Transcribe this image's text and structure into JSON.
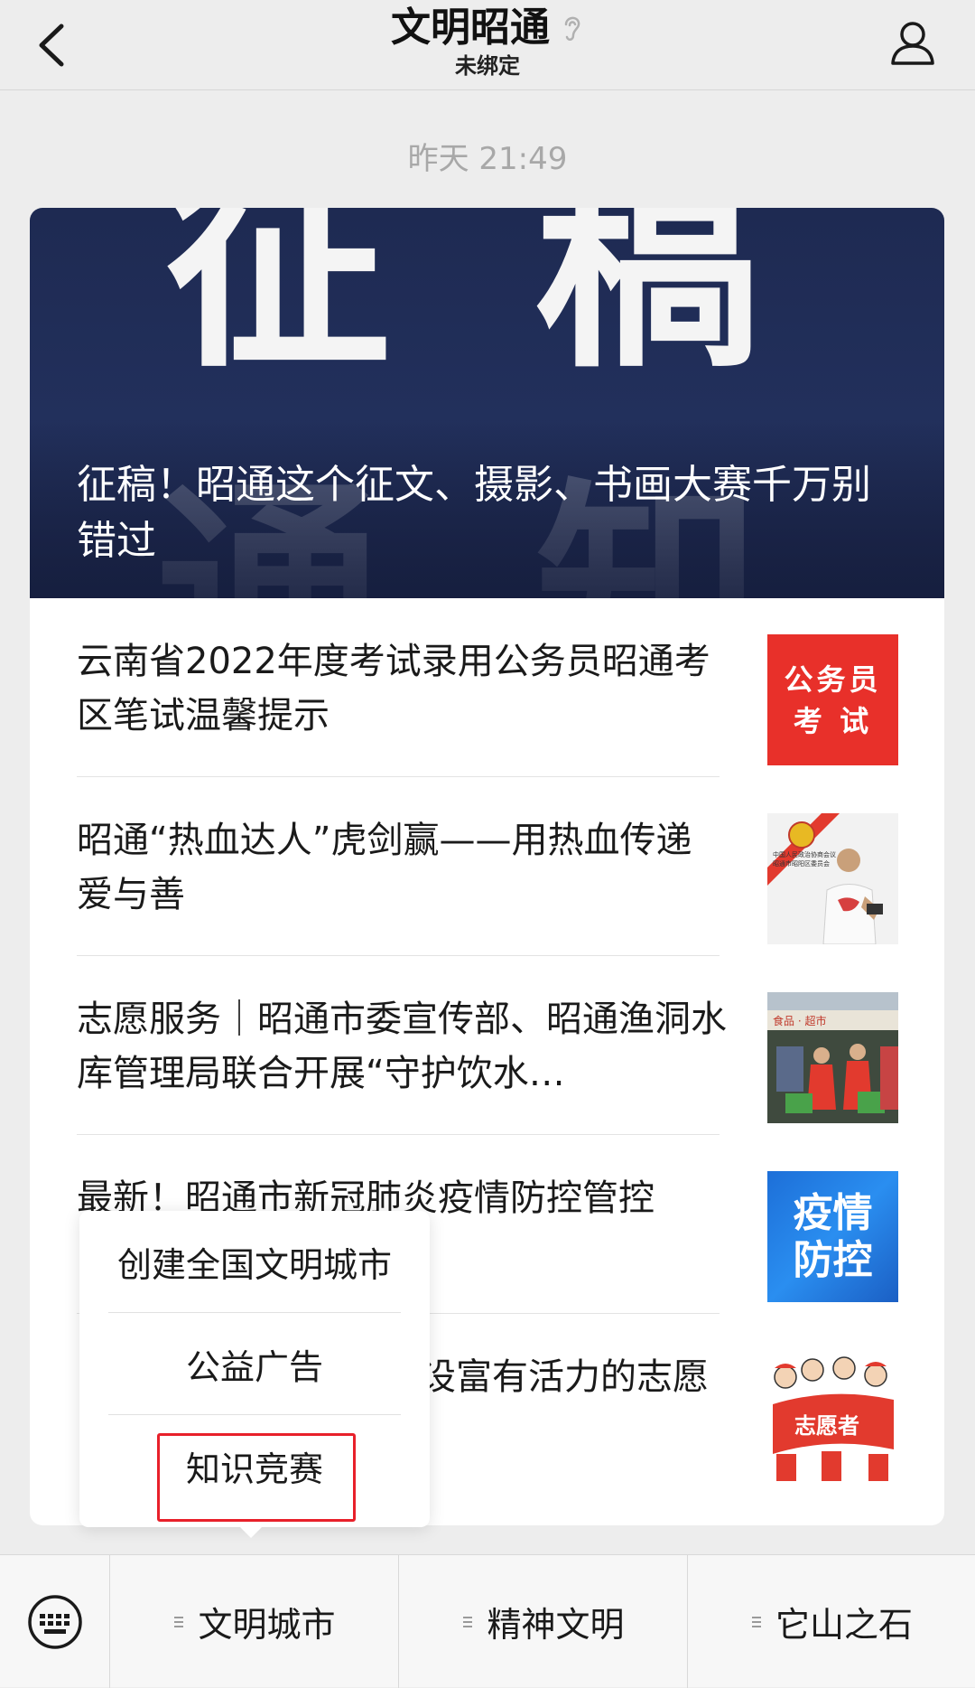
{
  "header": {
    "title": "文明昭通",
    "subtitle": "未绑定",
    "back_icon": "chevron-left-icon",
    "user_icon": "person-icon",
    "ear_icon": "ear-icon"
  },
  "timestamp": "昨天 21:49",
  "cover": {
    "bg_glyphs": [
      "征",
      "稿",
      "通",
      "知"
    ],
    "title": "征稿！昭通这个征文、摄影、书画大赛千万别错过"
  },
  "articles": [
    {
      "title": "云南省2022年度考试录用公务员昭通考区笔试温馨提示",
      "thumb": {
        "type": "text",
        "lines": [
          "公务员",
          "考 试"
        ]
      }
    },
    {
      "title": "昭通“热血达人”虎剑赢——用热血传递爱与善",
      "thumb": {
        "type": "photo",
        "caption_lines": [
          "中国人民政治协商会议",
          "昭通市昭阳区委员会"
        ]
      }
    },
    {
      "title": "志愿服务｜昭通市委宣传部、昭通渔洞水库管理局联合开展“守护饮水…",
      "thumb": {
        "type": "photo",
        "caption_lines": [
          "食品 · 超市"
        ]
      }
    },
    {
      "title": "最新！昭通市新冠肺炎疫情防控管控",
      "thumb": {
        "type": "text",
        "lines": [
          "疫情",
          "防控"
        ]
      }
    },
    {
      "title": "设富有活力的志愿",
      "thumb": {
        "type": "cartoon",
        "banner": "志愿者"
      }
    }
  ],
  "popup_menu": {
    "items": [
      "创建全国文明城市",
      "公益广告",
      "知识竞赛"
    ],
    "highlighted_index": 2,
    "highlight_color": "#e8202a"
  },
  "menubar": {
    "keyboard_icon": "keyboard-icon",
    "tabs": [
      "文明城市",
      "精神文明",
      "它山之石"
    ],
    "tab_icon": "menu-list-icon"
  },
  "colors": {
    "background": "#ededed",
    "cover_bg": "#1e2a52",
    "accent_red": "#e8302a",
    "accent_blue": "#1d6fd8"
  }
}
